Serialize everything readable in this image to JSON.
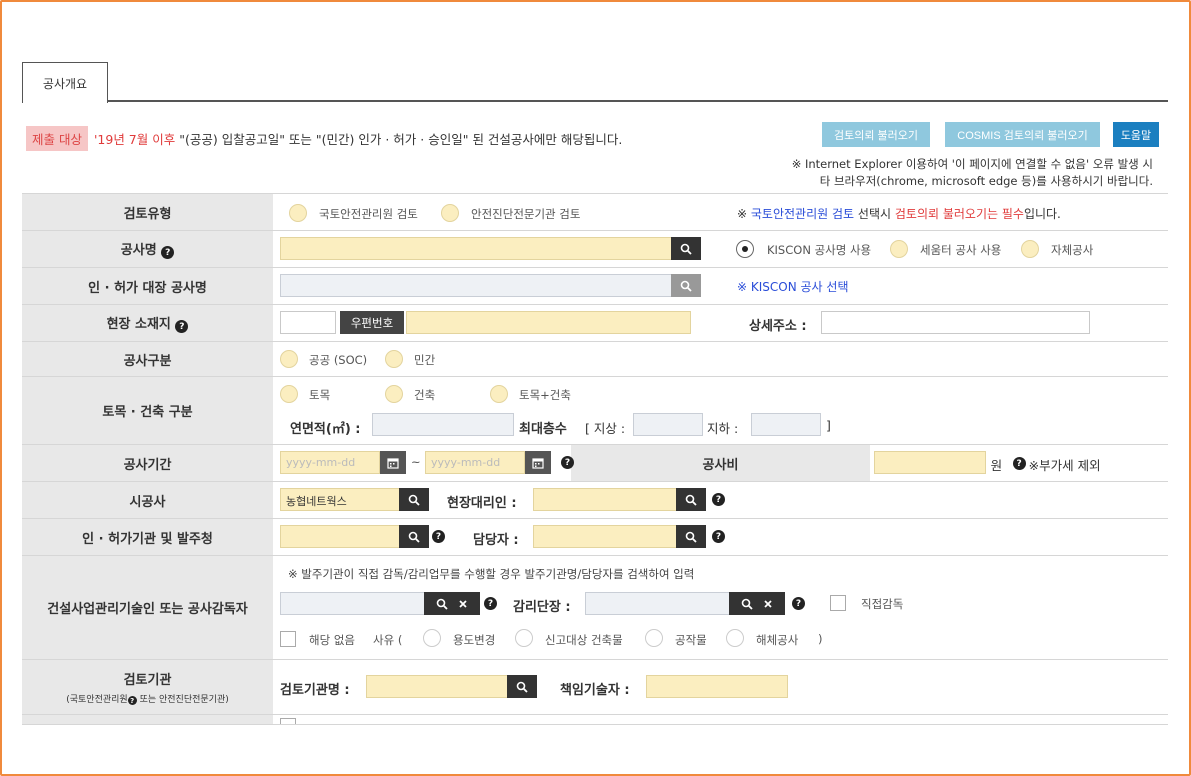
{
  "tab": {
    "label": "공사개요"
  },
  "notice": {
    "tag": "제출 대상",
    "highlight": "'19년 7월 이후",
    "text": "\"(공공) 입찰공고일\" 또는 \"(민간) 인가 · 허가 · 승인일\" 된 건설공사에만 해당됩니다."
  },
  "top_buttons": {
    "review_load": "검토의뢰 불러오기",
    "cosmis_load": "COSMIS 검토의뢰 불러오기",
    "help": "도움말"
  },
  "ie_note": {
    "line1": "※ Internet Explorer 이용하여 '이 페이지에 연결할 수 없음' 오류 발생 시",
    "line2": "타 브라우저(chrome, microsoft edge 등)를 사용하시기 바랍니다."
  },
  "rows": {
    "review_type": {
      "label": "검토유형",
      "opt1": "국토안전관리원 검토",
      "opt2": "안전진단전문기관 검토",
      "note_prefix": "※",
      "note_blue": "국토안전관리원 검토",
      "note_mid": "선택시",
      "note_red": "검토의뢰 불러오기는 필수",
      "note_suffix": "입니다."
    },
    "project_name": {
      "label": "공사명",
      "opt1": "KISCON 공사명 사용",
      "opt2": "세움터 공사 사용",
      "opt3": "자체공사"
    },
    "permit_name": {
      "label": "인 · 허가 대장 공사명",
      "link": "※ KISCON 공사 선택"
    },
    "site_address": {
      "label": "현장 소재지",
      "zip_button": "우편번호",
      "detail_label": "상세주소 :"
    },
    "project_class": {
      "label": "공사구분",
      "opt1": "공공 (SOC)",
      "opt2": "민간"
    },
    "civil_building": {
      "label": "토목 · 건축 구분",
      "opt1": "토목",
      "opt2": "건축",
      "opt3": "토목+건축",
      "area_label": "연면적(㎡) :",
      "floors_label": "최대층수",
      "above_label": "[ 지상 :",
      "below_label": "지하 :",
      "close_bracket": "]"
    },
    "period": {
      "label": "공사기간",
      "start_placeholder": "yyyy-mm-dd",
      "tilde": "~",
      "end_placeholder": "yyyy-mm-dd",
      "cost_label": "공사비",
      "unit": "원",
      "vat_note": "※부가세 제외"
    },
    "contractor": {
      "label": "시공사",
      "value": "농협네트웍스",
      "agent_label": "현장대리인 :"
    },
    "permit_agency": {
      "label": "인 · 허가기관 및 발주청",
      "manager_label": "담당자 :"
    },
    "supervisor": {
      "label": "건설사업관리기술인 또는 공사감독자",
      "note": "※ 발주기관이 직접 감독/감리업무를 수행할 경우 발주기관명/담당자를 검색하여 입력",
      "chief_label": "감리단장 :",
      "direct": "직접감독",
      "none": "해당 없음",
      "reason": "사유 (",
      "r1": "용도변경",
      "r2": "신고대상 건축물",
      "r3": "공작물",
      "r4": "해체공사",
      "close": ")"
    },
    "review_org": {
      "label": "검토기관",
      "sublabel": "(국토안전관리원",
      "sublabel2": "또는 안전진단전문기관)",
      "org_label": "검토기관명 :",
      "engineer_label": "책임기술자 :"
    }
  },
  "icons": {
    "search": "search-icon",
    "calendar": "calendar-icon",
    "help": "question-icon",
    "clear": "close-icon"
  }
}
